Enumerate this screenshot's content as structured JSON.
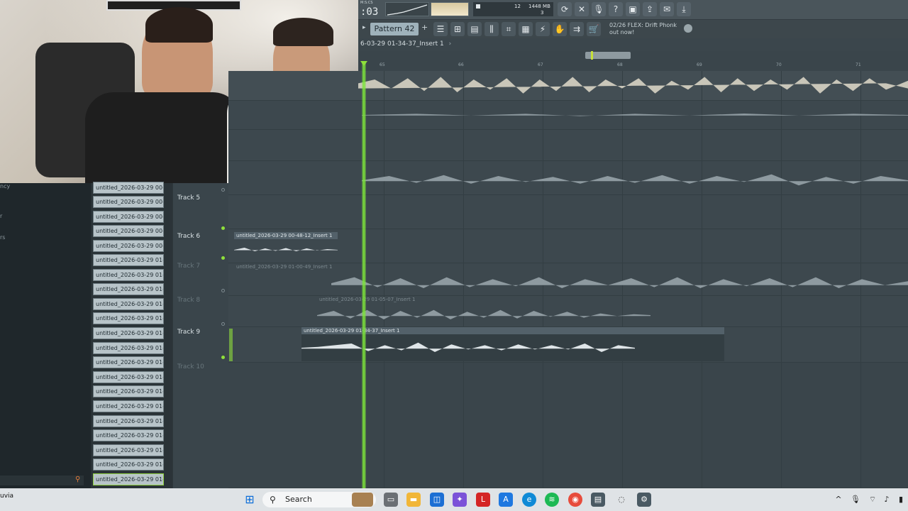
{
  "toolbar": {
    "time": ":03",
    "time_label": "M:S:CS",
    "cpu_value": "12",
    "memory": "1448 MB",
    "polyphony": "3",
    "pattern": "Pattern 42",
    "news_line1": "02/26  FLEX: Drift Phonk",
    "news_line2": "out now!"
  },
  "playlist": {
    "title": "6-03-29 01-34-37_Insert 1",
    "ruler": [
      "65",
      "66",
      "67",
      "68",
      "69",
      "70",
      "71"
    ]
  },
  "left_panel": {
    "fragment1": "ncy",
    "fragment2": "r",
    "fragment3": "rs"
  },
  "browser": {
    "items": [
      "untitled_2026-03-29 00-...",
      "untitled_2026-03-29 00-...",
      "untitled_2026-03-29 00-...",
      "untitled_2026-03-29 00-...",
      "untitled_2026-03-29 00-...",
      "untitled_2026-03-29 01-...",
      "untitled_2026-03-29 01-...",
      "untitled_2026-03-29 01-...",
      "untitled_2026-03-29 01-...",
      "untitled_2026-03-29 01-...",
      "untitled_2026-03-29 01-...",
      "untitled_2026-03-29 01-...",
      "untitled_2026-03-29 01-...",
      "untitled_2026-03-29 01-...",
      "untitled_2026-03-29 01-...",
      "untitled_2026-03-29 01-...",
      "untitled_2026-03-29 01-...",
      "untitled_2026-03-29 01-...",
      "untitled_2026-03-29 01-...",
      "untitled_2026-03-29 01-...",
      "untitled_2026-03-29 01-..."
    ]
  },
  "tracks": [
    {
      "name": "Track 5",
      "dim": false
    },
    {
      "name": "Track 6",
      "dim": false
    },
    {
      "name": "Track 7",
      "dim": true
    },
    {
      "name": "Track 8",
      "dim": true
    },
    {
      "name": "Track 9",
      "dim": false
    },
    {
      "name": "Track 10",
      "dim": true
    }
  ],
  "clips": {
    "track6": "untitled_2026-03-29 00-48-12_Insert 1",
    "track7": "untitled_2026-03-29 01-00-49_Insert 1",
    "track8": "untitled_2026-03-29 01-05-07_Insert 1",
    "track9": "untitled_2026-03-29 01-34-37_Insert 1"
  },
  "taskbar": {
    "search_label": "Search",
    "left_text": "uvia",
    "colors": {
      "accent": "#0a6cd8",
      "green": "#8fe03a"
    }
  }
}
